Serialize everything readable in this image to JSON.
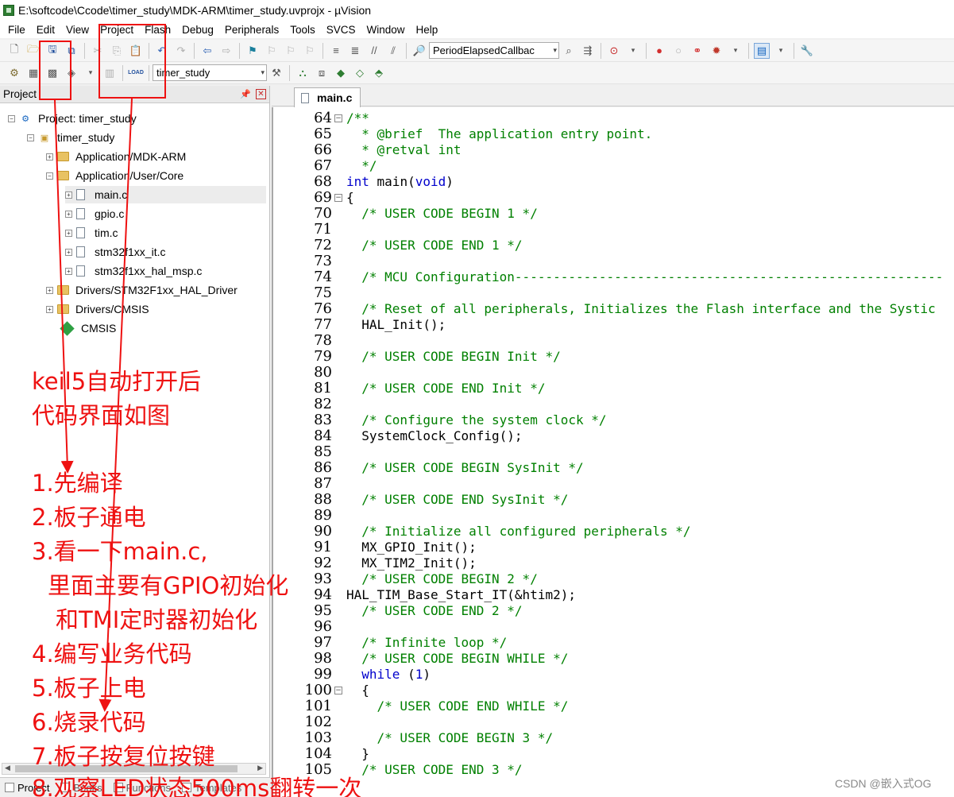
{
  "window": {
    "title": "E:\\softcode\\Ccode\\timer_study\\MDK-ARM\\timer_study.uvprojx - µVision"
  },
  "menu": [
    "File",
    "Edit",
    "View",
    "Project",
    "Flash",
    "Debug",
    "Peripherals",
    "Tools",
    "SVCS",
    "Window",
    "Help"
  ],
  "toolbar": {
    "function_combo": "PeriodElapsedCallbac",
    "target_combo": "timer_study"
  },
  "project_panel": {
    "title": "Project",
    "tree": [
      {
        "label": "Project: timer_study"
      },
      {
        "label": "timer_study"
      },
      {
        "label": "Application/MDK-ARM"
      },
      {
        "label": "Application/User/Core"
      },
      {
        "label": "main.c"
      },
      {
        "label": "gpio.c"
      },
      {
        "label": "tim.c"
      },
      {
        "label": "stm32f1xx_it.c"
      },
      {
        "label": "stm32f1xx_hal_msp.c"
      },
      {
        "label": "Drivers/STM32F1xx_HAL_Driver"
      },
      {
        "label": "Drivers/CMSIS"
      },
      {
        "label": "CMSIS"
      }
    ],
    "bottom_tabs": [
      "Project",
      "Books",
      "Functions",
      "Templates"
    ]
  },
  "editor": {
    "tab": "main.c",
    "lines": [
      {
        "n": "64",
        "fold": "−",
        "code": "/**"
      },
      {
        "n": "65",
        "fold": "",
        "code": "  * @brief  The application entry point."
      },
      {
        "n": "66",
        "fold": "",
        "code": "  * @retval int"
      },
      {
        "n": "67",
        "fold": "",
        "code": "  */"
      },
      {
        "n": "68",
        "fold": "",
        "code": "int main(void)"
      },
      {
        "n": "69",
        "fold": "−",
        "code": "{"
      },
      {
        "n": "70",
        "fold": "",
        "code": "  /* USER CODE BEGIN 1 */"
      },
      {
        "n": "71",
        "fold": "",
        "code": ""
      },
      {
        "n": "72",
        "fold": "",
        "code": "  /* USER CODE END 1 */"
      },
      {
        "n": "73",
        "fold": "",
        "code": ""
      },
      {
        "n": "74",
        "fold": "",
        "code": "  /* MCU Configuration--------------------------------------------------------"
      },
      {
        "n": "75",
        "fold": "",
        "code": ""
      },
      {
        "n": "76",
        "fold": "",
        "code": "  /* Reset of all peripherals, Initializes the Flash interface and the Systic"
      },
      {
        "n": "77",
        "fold": "",
        "code": "  HAL_Init();"
      },
      {
        "n": "78",
        "fold": "",
        "code": ""
      },
      {
        "n": "79",
        "fold": "",
        "code": "  /* USER CODE BEGIN Init */"
      },
      {
        "n": "80",
        "fold": "",
        "code": ""
      },
      {
        "n": "81",
        "fold": "",
        "code": "  /* USER CODE END Init */"
      },
      {
        "n": "82",
        "fold": "",
        "code": ""
      },
      {
        "n": "83",
        "fold": "",
        "code": "  /* Configure the system clock */"
      },
      {
        "n": "84",
        "fold": "",
        "code": "  SystemClock_Config();"
      },
      {
        "n": "85",
        "fold": "",
        "code": ""
      },
      {
        "n": "86",
        "fold": "",
        "code": "  /* USER CODE BEGIN SysInit */"
      },
      {
        "n": "87",
        "fold": "",
        "code": ""
      },
      {
        "n": "88",
        "fold": "",
        "code": "  /* USER CODE END SysInit */"
      },
      {
        "n": "89",
        "fold": "",
        "code": ""
      },
      {
        "n": "90",
        "fold": "",
        "code": "  /* Initialize all configured peripherals */"
      },
      {
        "n": "91",
        "fold": "",
        "code": "  MX_GPIO_Init();"
      },
      {
        "n": "92",
        "fold": "",
        "code": "  MX_TIM2_Init();"
      },
      {
        "n": "93",
        "fold": "",
        "code": "  /* USER CODE BEGIN 2 */"
      },
      {
        "n": "94",
        "fold": "",
        "code": "HAL_TIM_Base_Start_IT(&htim2);"
      },
      {
        "n": "95",
        "fold": "",
        "code": "  /* USER CODE END 2 */"
      },
      {
        "n": "96",
        "fold": "",
        "code": ""
      },
      {
        "n": "97",
        "fold": "",
        "code": "  /* Infinite loop */"
      },
      {
        "n": "98",
        "fold": "",
        "code": "  /* USER CODE BEGIN WHILE */"
      },
      {
        "n": "99",
        "fold": "",
        "code": "  while (1)"
      },
      {
        "n": "100",
        "fold": "−",
        "code": "  {"
      },
      {
        "n": "101",
        "fold": "",
        "code": "    /* USER CODE END WHILE */"
      },
      {
        "n": "102",
        "fold": "",
        "code": ""
      },
      {
        "n": "103",
        "fold": "",
        "code": "    /* USER CODE BEGIN 3 */"
      },
      {
        "n": "104",
        "fold": "",
        "code": "  }"
      },
      {
        "n": "105",
        "fold": "",
        "code": "  /* USER CODE END 3 */"
      }
    ]
  },
  "annotations": {
    "heading_1": "keil5自动打开后",
    "heading_2": "代码界面如图",
    "steps": [
      "1.先编译",
      "2.板子通电",
      "3.看一下main.c,",
      "里面主要有GPIO初始化",
      "和TMI定时器初始化",
      "4.编写业务代码",
      "5.板子上电",
      "6.烧录代码",
      "7.板子按复位按键",
      "8.观察LED状态500ms翻转一次"
    ],
    "color": "#ee1111"
  },
  "watermark": "CSDN @嵌入式OG"
}
